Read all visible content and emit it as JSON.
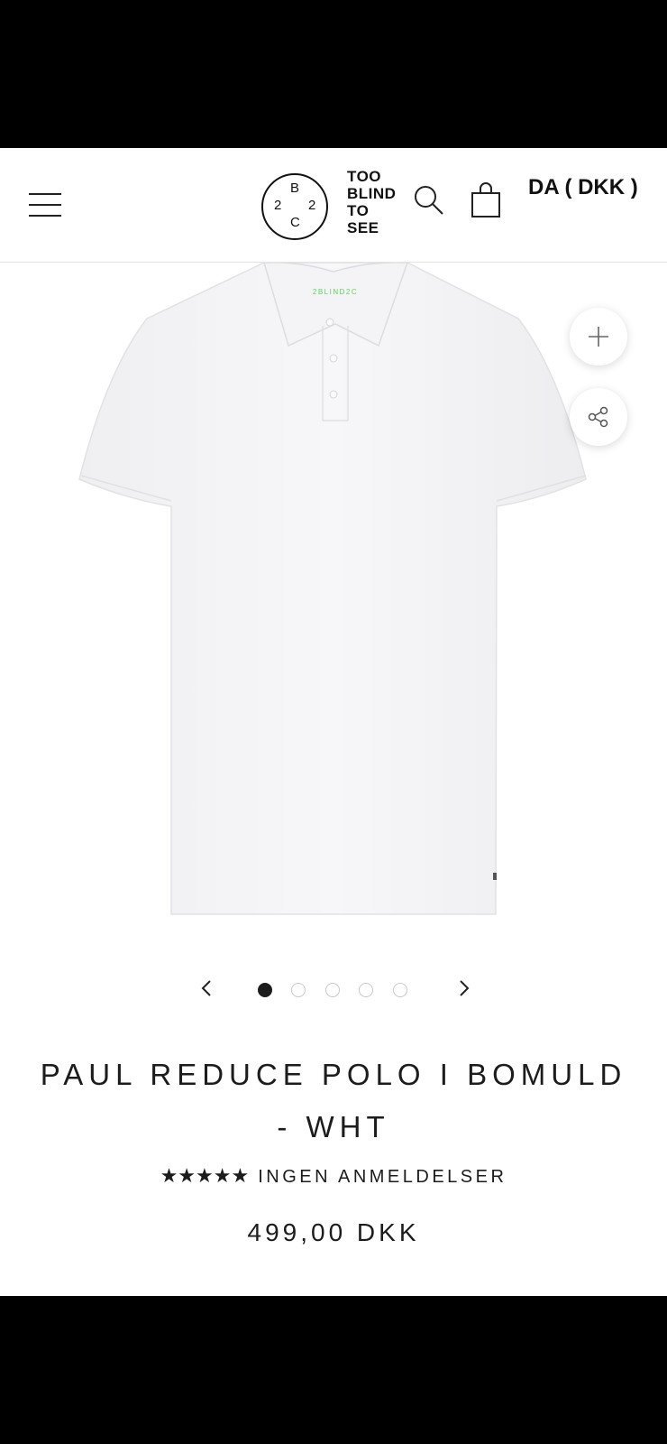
{
  "header": {
    "logo_circle": {
      "top": "B",
      "left": "2",
      "right": "2",
      "bottom": "C"
    },
    "logo_text": [
      "TOO",
      "BLIND",
      "TO",
      "SEE"
    ],
    "currency_label": "DA ( DKK )"
  },
  "product": {
    "collar_label": "2BLIND2C",
    "title": "PAUL REDUCE POLO I BOMULD - WHT",
    "rating_stars": "★★★★★",
    "reviews_label": "INGEN ANMELDELSER",
    "price": "499,00 DKK",
    "image_count": 5,
    "active_image": 1
  },
  "colors": {
    "text": "#1c1c1c",
    "background": "#ffffff",
    "frame": "#000000",
    "collar_accent": "#5fd35f"
  }
}
